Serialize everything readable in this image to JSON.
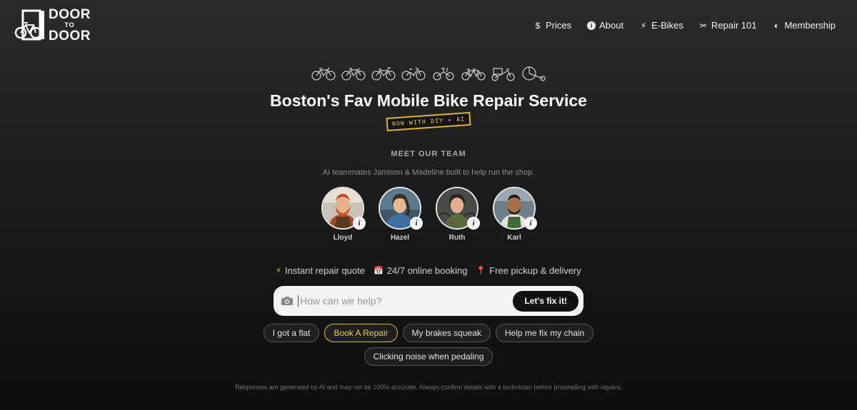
{
  "logo": {
    "line1": "DOOR",
    "line2": "TO",
    "line3": "DOOR"
  },
  "nav": [
    {
      "icon": "dollar-icon",
      "glyph": "$",
      "label": "Prices"
    },
    {
      "icon": "info-icon",
      "glyph": "i",
      "label": "About"
    },
    {
      "icon": "bolt-icon",
      "glyph": "⚡",
      "label": "E-Bikes"
    },
    {
      "icon": "wrench-icon",
      "glyph": "✂",
      "label": "Repair 101"
    },
    {
      "icon": "shield-icon",
      "glyph": "◐",
      "label": "Membership"
    }
  ],
  "hero": {
    "title": "Boston's Fav Mobile Bike Repair Service",
    "badge": "NOW WITH DIY + AI"
  },
  "team": {
    "heading": "MEET OUR TEAM",
    "subtitle": "AI teammates Jamison & Madeline built to help run the shop.",
    "members": [
      {
        "name": "Lloyd"
      },
      {
        "name": "Hazel"
      },
      {
        "name": "Ruth"
      },
      {
        "name": "Karl"
      }
    ]
  },
  "features": [
    {
      "icon": "bolt-icon",
      "glyph": "⚡",
      "label": "Instant repair quote"
    },
    {
      "icon": "calendar-icon",
      "glyph": "📅",
      "label": "24/7 online booking"
    },
    {
      "icon": "pin-icon",
      "glyph": "📍",
      "label": "Free pickup & delivery"
    }
  ],
  "search": {
    "placeholder": "How can we help?",
    "button": "Let's fix it!"
  },
  "chips": {
    "row1": [
      "I got a flat",
      "Book A Repair",
      "My brakes squeak",
      "Help me fix my chain"
    ],
    "row2": [
      "Clicking noise when pedaling"
    ]
  },
  "disclaimer": "Responses are generated by AI and may not be 100% accurate. Always confirm details with a technician before proceeding with repairs.",
  "colors": {
    "accent": "#d8b63a",
    "background": "#1c1c1c",
    "search_bg": "#f4f4f4"
  }
}
